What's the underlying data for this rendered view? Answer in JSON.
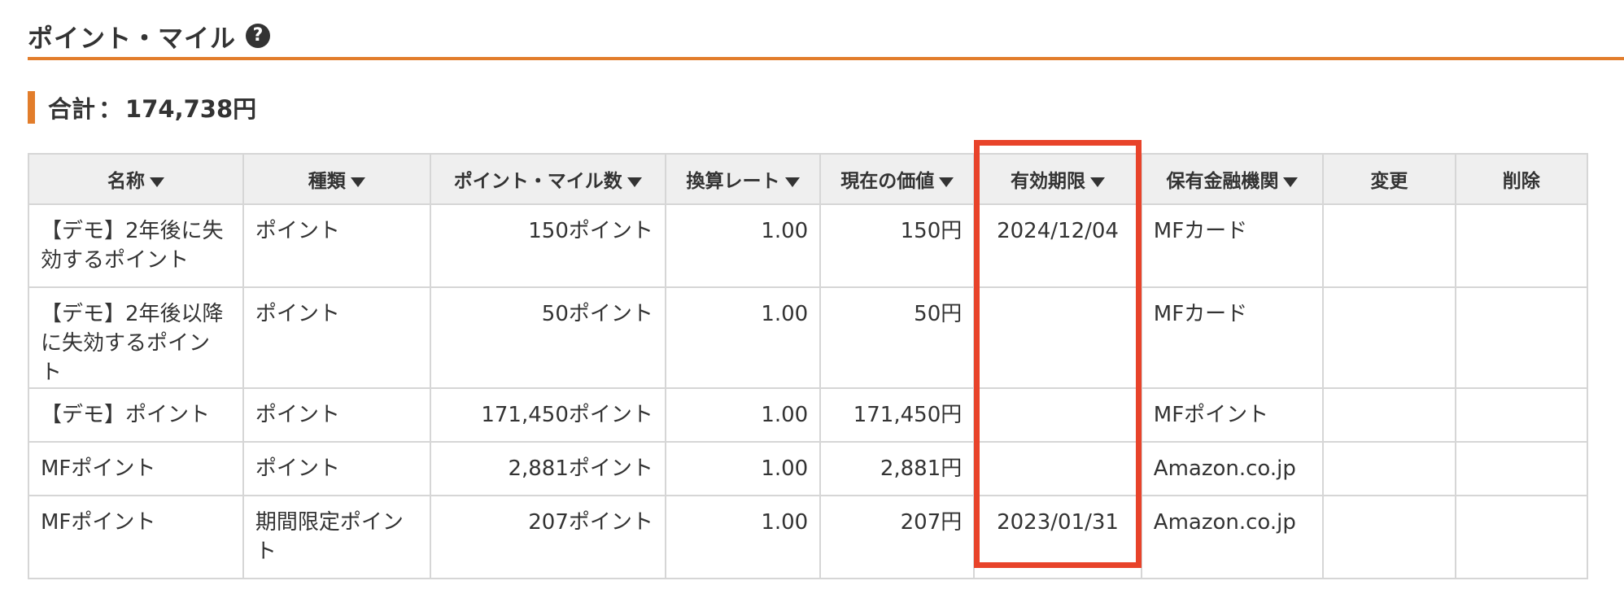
{
  "section": {
    "title": "ポイント・マイル",
    "help_icon": "question-circle-icon",
    "help_glyph": "?"
  },
  "total": {
    "label": "合計",
    "separator": "：",
    "value": "174,738円"
  },
  "table": {
    "headers": {
      "name": "名称",
      "type": "種類",
      "points": "ポイント・マイル数",
      "rate": "換算レート",
      "value": "現在の価値",
      "expiry": "有効期限",
      "institution": "保有金融機関",
      "edit": "変更",
      "delete": "削除"
    },
    "rows": [
      {
        "name": "【デモ】2年後に失効するポイント",
        "type": "ポイント",
        "points": "150ポイント",
        "rate": "1.00",
        "value": "150円",
        "expiry": "2024/12/04",
        "institution": "MFカード"
      },
      {
        "name": "【デモ】2年後以降に失効するポイント",
        "type": "ポイント",
        "points": "50ポイント",
        "rate": "1.00",
        "value": "50円",
        "expiry": "",
        "institution": "MFカード"
      },
      {
        "name": "【デモ】ポイント",
        "type": "ポイント",
        "points": "171,450ポイント",
        "rate": "1.00",
        "value": "171,450円",
        "expiry": "",
        "institution": "MFポイント"
      },
      {
        "name": "MFポイント",
        "type": "ポイント",
        "points": "2,881ポイント",
        "rate": "1.00",
        "value": "2,881円",
        "expiry": "",
        "institution": "Amazon.co.jp"
      },
      {
        "name": "MFポイント",
        "type": "期間限定ポイント",
        "points": "207ポイント",
        "rate": "1.00",
        "value": "207円",
        "expiry": "2023/01/31",
        "institution": "Amazon.co.jp"
      }
    ]
  },
  "colors": {
    "accent_orange": "#e27d2b",
    "highlight_red": "#e8432a",
    "header_bg": "#efefef",
    "border": "#d6d6d6",
    "text": "#333333"
  },
  "annotation": {
    "highlight": "expiry-column"
  }
}
